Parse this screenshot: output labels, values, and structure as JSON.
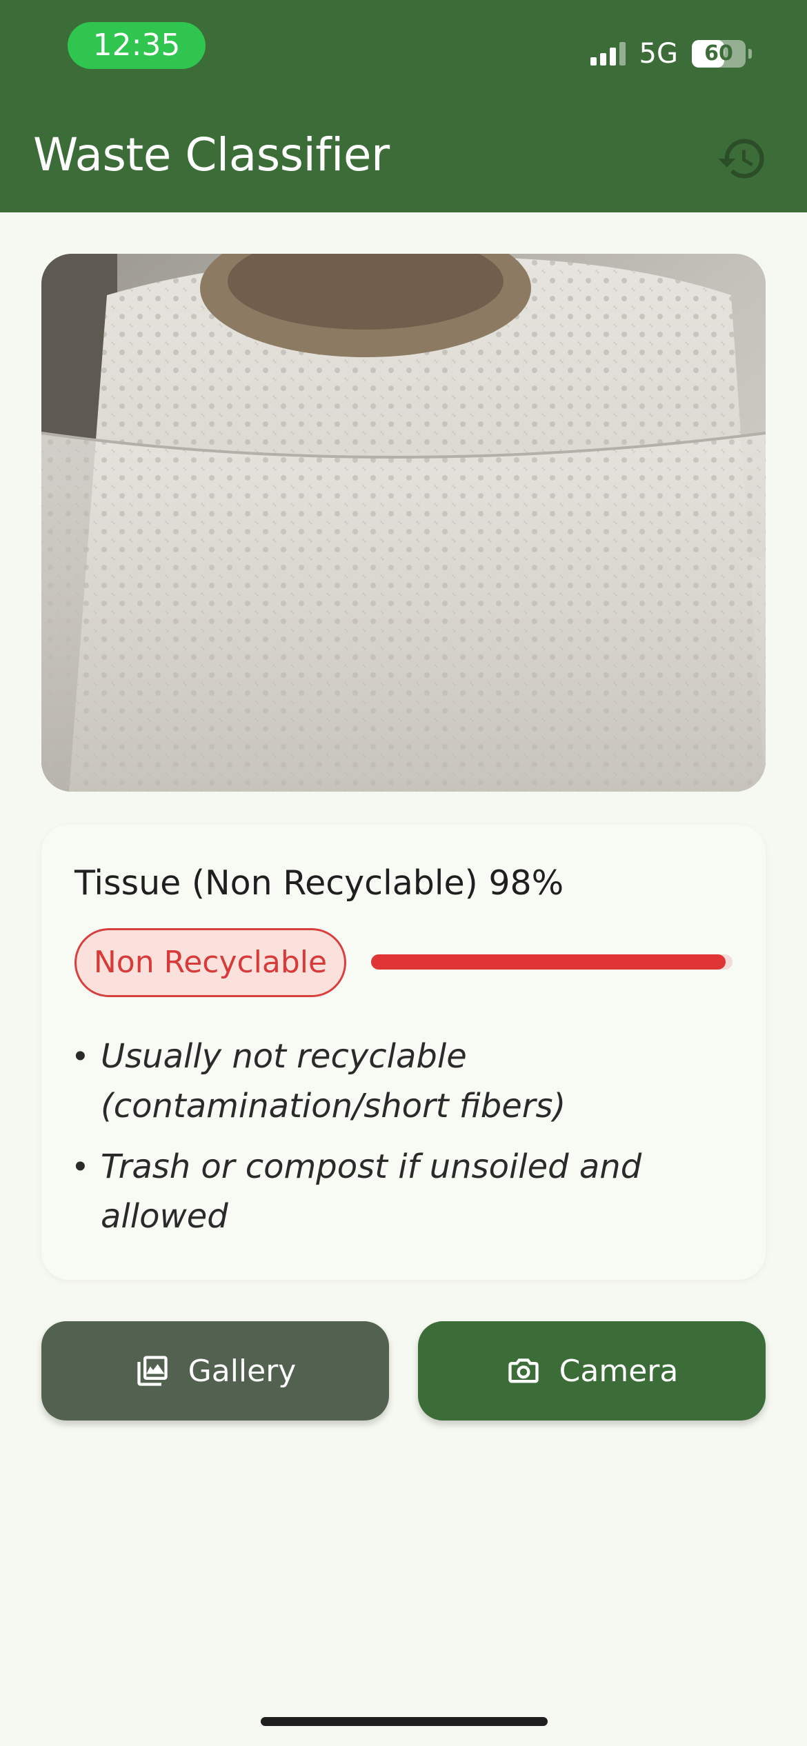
{
  "status_bar": {
    "time": "12:35",
    "network": "5G",
    "battery": "60",
    "battery_level": 0.6
  },
  "app_bar": {
    "title": "Waste Classifier",
    "history_icon": "history-icon"
  },
  "result": {
    "title": "Tissue (Non Recyclable) 98%",
    "badge": "Non Recyclable",
    "confidence": 0.98,
    "notes": [
      "Usually not recyclable (contamination/short fibers)",
      "Trash or compost if unsoiled and allowed"
    ]
  },
  "actions": {
    "gallery_label": "Gallery",
    "gallery_icon": "gallery-icon",
    "camera_label": "Camera",
    "camera_icon": "camera-icon"
  },
  "colors": {
    "primary": "#3c6d39",
    "secondary": "#526150",
    "background": "#f6f9f1",
    "non_recyclable": "#d83a3a"
  }
}
